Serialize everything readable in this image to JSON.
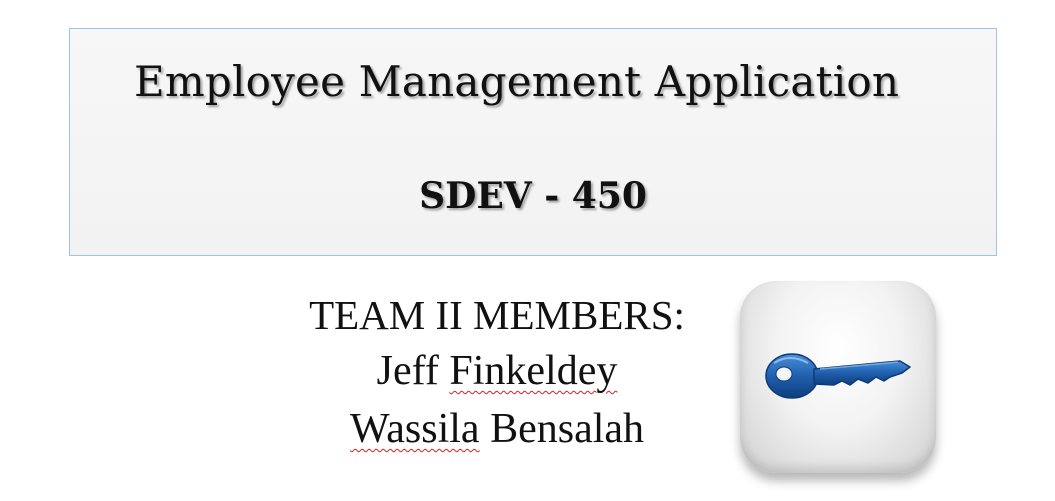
{
  "header": {
    "title": "Employee Management Application",
    "course": "SDEV - 450"
  },
  "team": {
    "heading": "TEAM II MEMBERS:",
    "member_1_first": "Jeff",
    "member_1_last": "Finkeldey",
    "member_2_first": "Wassila",
    "member_2_last": "Bensalah"
  },
  "icon": {
    "name": "key-icon",
    "color": "#1f5fae",
    "tile_color": "#f2f2f2"
  }
}
